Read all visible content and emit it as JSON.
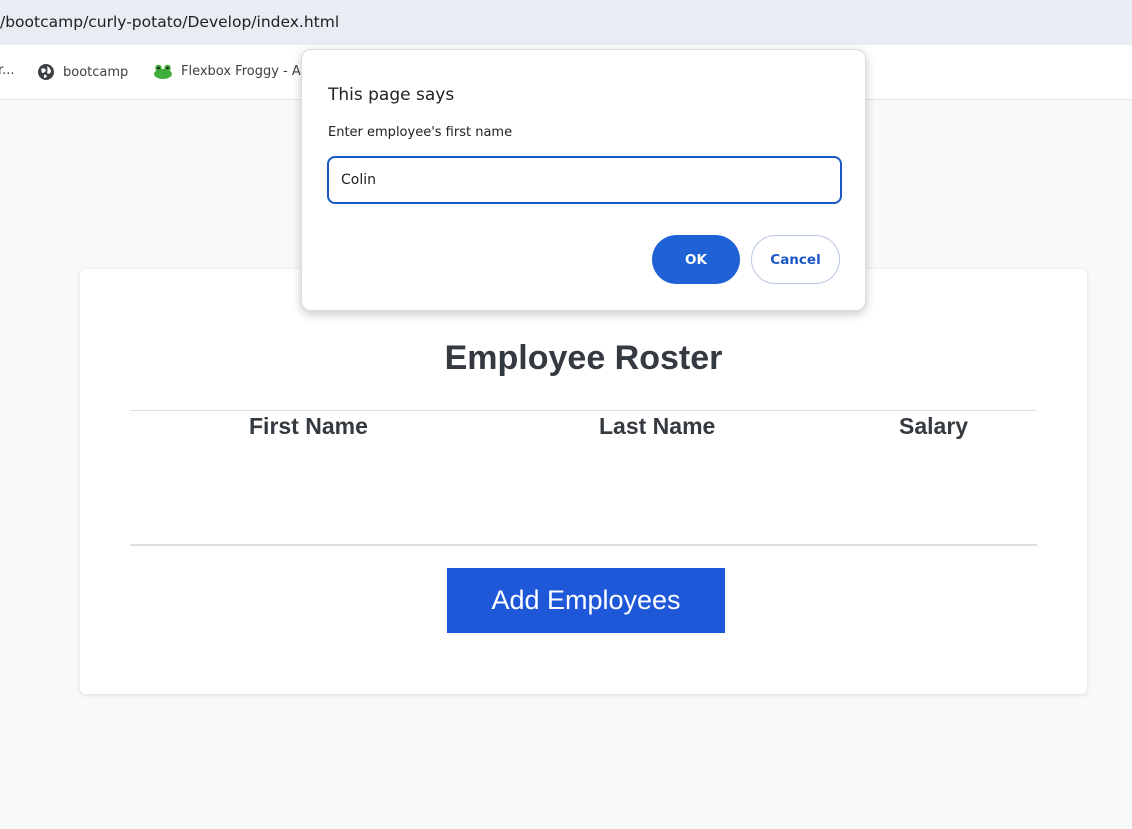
{
  "browser": {
    "url": "/bootcamp/curly-potato/Develop/index.html",
    "bookmarks": [
      {
        "label": "r..."
      },
      {
        "label": "bootcamp"
      },
      {
        "label": "Flexbox Froggy - A"
      }
    ]
  },
  "page": {
    "title": "Employee Roster",
    "table_headers": [
      "First Name",
      "Last Name",
      "Salary"
    ],
    "rows": [],
    "add_button_label": "Add Employees"
  },
  "dialog": {
    "title": "This page says",
    "message": "Enter employee's first name",
    "input_value": "Colin",
    "ok_label": "OK",
    "cancel_label": "Cancel"
  },
  "colors": {
    "accent": "#1e58d8",
    "dialog_ok": "#1e62d6",
    "text": "#343a40"
  }
}
